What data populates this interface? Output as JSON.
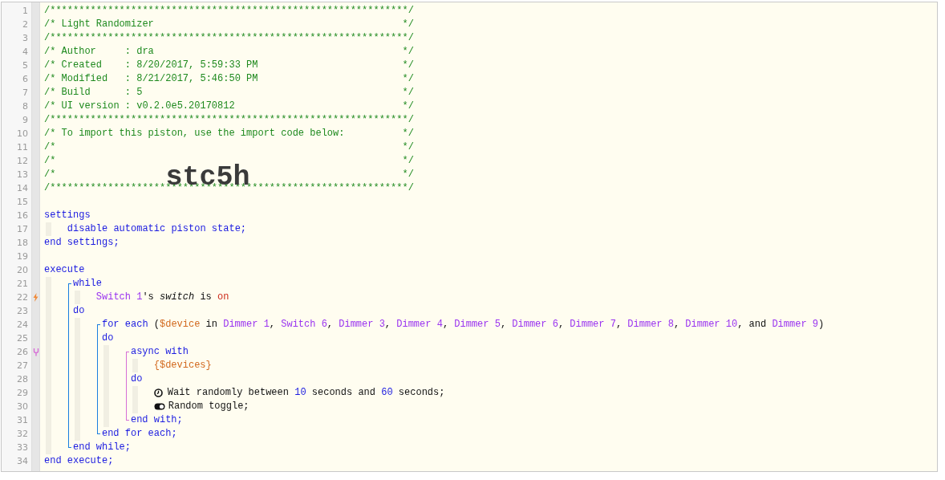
{
  "editor": {
    "lines": [
      {
        "number": "1",
        "tokens": [
          {
            "kind": "comment",
            "text": "/**************************************************************/"
          }
        ]
      },
      {
        "number": "2",
        "tokens": [
          {
            "kind": "comment",
            "text": "/* Light Randomizer"
          }
        ],
        "close": "*/"
      },
      {
        "number": "3",
        "tokens": [
          {
            "kind": "comment",
            "text": "/**************************************************************/"
          }
        ]
      },
      {
        "number": "4",
        "tokens": [
          {
            "kind": "comment",
            "text": "/* Author     : dra"
          }
        ],
        "close": "*/"
      },
      {
        "number": "5",
        "tokens": [
          {
            "kind": "comment",
            "text": "/* Created    : 8/20/2017, 5:59:33 PM"
          }
        ],
        "close": "*/"
      },
      {
        "number": "6",
        "tokens": [
          {
            "kind": "comment",
            "text": "/* Modified   : 8/21/2017, 5:46:50 PM"
          }
        ],
        "close": "*/"
      },
      {
        "number": "7",
        "tokens": [
          {
            "kind": "comment",
            "text": "/* Build      : 5"
          }
        ],
        "close": "*/"
      },
      {
        "number": "8",
        "tokens": [
          {
            "kind": "comment",
            "text": "/* UI version : v0.2.0e5.20170812"
          }
        ],
        "close": "*/"
      },
      {
        "number": "9",
        "tokens": [
          {
            "kind": "comment",
            "text": "/**************************************************************/"
          }
        ]
      },
      {
        "number": "10",
        "tokens": [
          {
            "kind": "comment",
            "text": "/* To import this piston, use the import code below:"
          }
        ],
        "close": "*/"
      },
      {
        "number": "11",
        "tokens": [
          {
            "kind": "comment",
            "text": "/*"
          }
        ],
        "close": "*/"
      },
      {
        "number": "12",
        "tokens": [
          {
            "kind": "comment",
            "text": "/*"
          }
        ],
        "close": "*/"
      },
      {
        "number": "13",
        "tokens": [
          {
            "kind": "comment",
            "text": "/*"
          },
          {
            "kind": "import_code",
            "text": "stc5h"
          }
        ],
        "close": "*/"
      },
      {
        "number": "14",
        "tokens": [
          {
            "kind": "comment",
            "text": "/**************************************************************/"
          }
        ]
      },
      {
        "number": "15"
      },
      {
        "kind": "block",
        "sections": [
          {
            "head": {
              "number": "16",
              "tokens": [
                {
                  "kind": "keyword",
                  "text": "settings"
                }
              ]
            },
            "body": [
              {
                "number": "17",
                "tokens": [
                  {
                    "kind": "keyword",
                    "text": "disable automatic piston state;"
                  }
                ]
              }
            ]
          }
        ],
        "tail": {
          "number": "18",
          "tokens": [
            {
              "kind": "keyword",
              "text": "end settings;"
            }
          ]
        }
      },
      {
        "number": "19"
      },
      {
        "kind": "block",
        "sections": [
          {
            "head": {
              "number": "20",
              "tokens": [
                {
                  "kind": "keyword",
                  "text": "execute"
                }
              ]
            },
            "body": [
              {
                "kind": "block",
                "color": "#1a7ee0",
                "sections": [
                  {
                    "head": {
                      "number": "21",
                      "tokens": [
                        {
                          "kind": "keyword",
                          "text": "while"
                        }
                      ]
                    },
                    "body": [
                      {
                        "number": "22",
                        "marker": {
                          "kind": "trigger"
                        },
                        "tokens": [
                          {
                            "kind": "device",
                            "text": "Switch 1"
                          },
                          {
                            "kind": "plain",
                            "text": "'s "
                          },
                          {
                            "kind": "italic",
                            "text": "switch"
                          },
                          {
                            "kind": "plain",
                            "text": " is "
                          },
                          {
                            "kind": "value",
                            "text": "on"
                          }
                        ]
                      }
                    ]
                  },
                  {
                    "head": {
                      "number": "23",
                      "tokens": [
                        {
                          "kind": "keyword",
                          "text": "do"
                        }
                      ]
                    },
                    "body": [
                      {
                        "kind": "block",
                        "color": "#1a7ee0",
                        "sections": [
                          {
                            "head": {
                              "number": "24",
                              "tokens": [
                                {
                                  "kind": "keyword",
                                  "text": "for each"
                                },
                                {
                                  "kind": "plain",
                                  "text": " ("
                                },
                                {
                                  "kind": "variable",
                                  "text": "$device"
                                },
                                {
                                  "kind": "plain",
                                  "text": " in "
                                },
                                {
                                  "kind": "device",
                                  "text": "Dimmer 1"
                                },
                                {
                                  "kind": "plain",
                                  "text": ", "
                                },
                                {
                                  "kind": "device",
                                  "text": "Switch 6"
                                },
                                {
                                  "kind": "plain",
                                  "text": ", "
                                },
                                {
                                  "kind": "device",
                                  "text": "Dimmer 3"
                                },
                                {
                                  "kind": "plain",
                                  "text": ", "
                                },
                                {
                                  "kind": "device",
                                  "text": "Dimmer 4"
                                },
                                {
                                  "kind": "plain",
                                  "text": ", "
                                },
                                {
                                  "kind": "device",
                                  "text": "Dimmer 5"
                                },
                                {
                                  "kind": "plain",
                                  "text": ", "
                                },
                                {
                                  "kind": "device",
                                  "text": "Dimmer 6"
                                },
                                {
                                  "kind": "plain",
                                  "text": ", "
                                },
                                {
                                  "kind": "device",
                                  "text": "Dimmer 7"
                                },
                                {
                                  "kind": "plain",
                                  "text": ", "
                                },
                                {
                                  "kind": "device",
                                  "text": "Dimmer 8"
                                },
                                {
                                  "kind": "plain",
                                  "text": ", "
                                },
                                {
                                  "kind": "device",
                                  "text": "Dimmer 10"
                                },
                                {
                                  "kind": "plain",
                                  "text": ", and "
                                },
                                {
                                  "kind": "device",
                                  "text": "Dimmer 9"
                                },
                                {
                                  "kind": "plain",
                                  "text": ")"
                                }
                              ]
                            }
                          },
                          {
                            "head": {
                              "number": "25",
                              "tokens": [
                                {
                                  "kind": "keyword",
                                  "text": "do"
                                }
                              ]
                            },
                            "body": [
                              {
                                "kind": "block",
                                "color": "#d66fd6",
                                "sections": [
                                  {
                                    "head": {
                                      "number": "26",
                                      "marker": {
                                        "kind": "async"
                                      },
                                      "tokens": [
                                        {
                                          "kind": "keyword",
                                          "text": "async with"
                                        }
                                      ]
                                    },
                                    "body": [
                                      {
                                        "number": "27",
                                        "tokens": [
                                          {
                                            "kind": "variable",
                                            "text": "{$devices}"
                                          }
                                        ]
                                      }
                                    ]
                                  },
                                  {
                                    "head": {
                                      "number": "28",
                                      "tokens": [
                                        {
                                          "kind": "keyword",
                                          "text": "do"
                                        }
                                      ]
                                    },
                                    "body": [
                                      {
                                        "number": "29",
                                        "kind": "wait",
                                        "tokens": [
                                          {
                                            "kind": "plain",
                                            "text": "Wait randomly between "
                                          },
                                          {
                                            "kind": "number",
                                            "text": "10"
                                          },
                                          {
                                            "kind": "plain",
                                            "text": " seconds and "
                                          },
                                          {
                                            "kind": "number",
                                            "text": "60"
                                          },
                                          {
                                            "kind": "plain",
                                            "text": " seconds;"
                                          }
                                        ]
                                      },
                                      {
                                        "number": "30",
                                        "kind": "toggle",
                                        "tokens": [
                                          {
                                            "kind": "plain",
                                            "text": "Random toggle;"
                                          }
                                        ]
                                      }
                                    ]
                                  }
                                ],
                                "tail": {
                                  "number": "31",
                                  "tokens": [
                                    {
                                      "kind": "keyword",
                                      "text": "end with;"
                                    }
                                  ]
                                }
                              }
                            ]
                          }
                        ],
                        "tail": {
                          "number": "32",
                          "tokens": [
                            {
                              "kind": "keyword",
                              "text": "end for each;"
                            }
                          ]
                        }
                      }
                    ]
                  }
                ],
                "tail": {
                  "number": "33",
                  "tokens": [
                    {
                      "kind": "keyword",
                      "text": "end while;"
                    }
                  ]
                }
              }
            ]
          }
        ],
        "tail": {
          "number": "34",
          "tokens": [
            {
              "kind": "keyword",
              "text": "end execute;"
            }
          ]
        }
      }
    ]
  }
}
